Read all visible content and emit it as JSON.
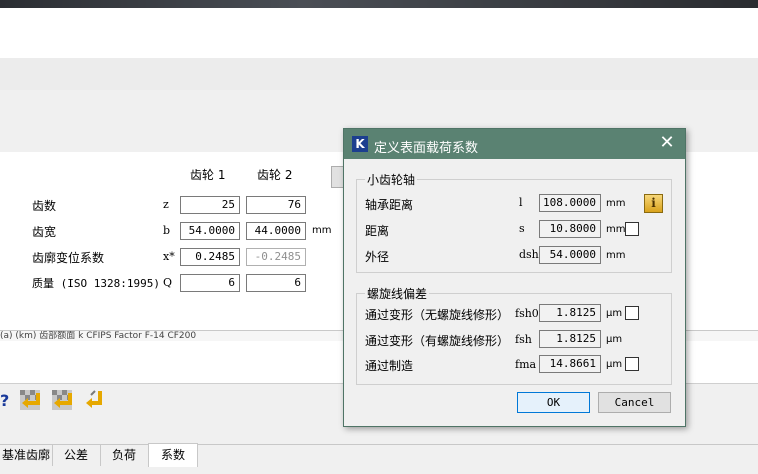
{
  "main": {
    "gear_headers": [
      "齿轮 1",
      "齿轮 2"
    ],
    "rows": [
      {
        "label": "齿数",
        "symbol": "z",
        "v1": "25",
        "v2": "76",
        "unit": ""
      },
      {
        "label": "齿宽",
        "symbol": "b",
        "v1": "54.0000",
        "v2": "44.0000",
        "unit": "mm"
      },
      {
        "label": "齿廓变位系数",
        "symbol": "x*",
        "v1": "0.2485",
        "v2": "-0.2485",
        "unit": ""
      },
      {
        "label": "质量 (ISO 1328:1995)",
        "symbol": "Q",
        "v1": "6",
        "v2": "6",
        "unit": ""
      }
    ],
    "status_text": "(a) (km) 齿部额面 k  CFIPS Factor F-14  CF200"
  },
  "tabs": [
    "基准齿廓",
    "公差",
    "负荷",
    "系数"
  ],
  "active_tab": "系数",
  "dialog": {
    "title": "定义表面载荷系数",
    "close_symbol": "✕",
    "logo_letter": "K",
    "group1": {
      "title": "小齿轮轴",
      "rows": [
        {
          "label": "轴承距离",
          "symbol": "l",
          "value": "108.0000",
          "unit": "mm"
        },
        {
          "label": "距离",
          "symbol": "s",
          "value": "10.8000",
          "unit": "mm"
        },
        {
          "label": "外径",
          "symbol": "dsh",
          "value": "54.0000",
          "unit": "mm"
        }
      ]
    },
    "group2": {
      "title": "螺旋线偏差",
      "rows": [
        {
          "label": "通过变形（无螺旋线修形）",
          "symbol": "fsh0",
          "value": "1.8125",
          "unit": "µm"
        },
        {
          "label": "通过变形（有螺旋线修形）",
          "symbol": "fsh",
          "value": "1.8125",
          "unit": "µm"
        },
        {
          "label": "通过制造",
          "symbol": "fma",
          "value": "14.8661",
          "unit": "µm"
        }
      ]
    },
    "ok_label": "OK",
    "cancel_label": "Cancel",
    "info_symbol": "i"
  }
}
